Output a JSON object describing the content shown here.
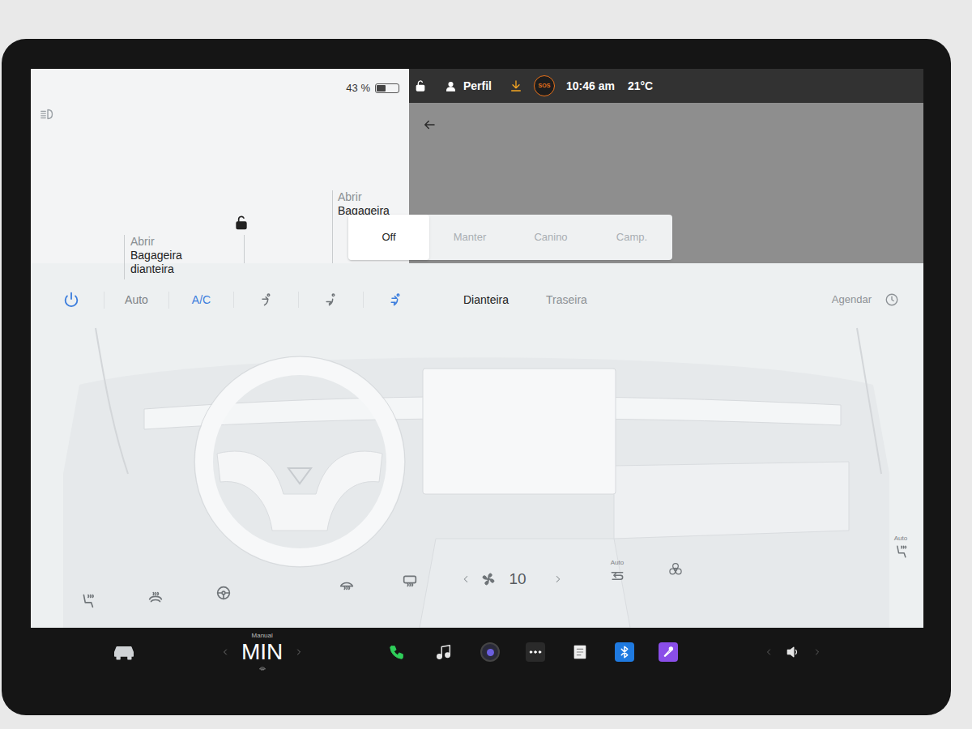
{
  "status_bar": {
    "battery": "43 %",
    "battery_level": 0.43,
    "locked": false,
    "profile": "Perfil",
    "sos": "SOS",
    "time": "10:46 am",
    "temperature": "21°C"
  },
  "car": {
    "locked": false,
    "frunk": {
      "action": "Abrir",
      "label": "Bagageira dianteira"
    },
    "trunk": {
      "action": "Abrir",
      "label": "Bagageira"
    }
  },
  "climate_keeper": [
    {
      "label": "Off",
      "selected": true,
      "disabled": false
    },
    {
      "label": "Manter",
      "selected": false,
      "disabled": true
    },
    {
      "label": "Canino",
      "selected": false,
      "disabled": true
    },
    {
      "label": "Camp.",
      "selected": false,
      "disabled": true
    }
  ],
  "climate": {
    "power": true,
    "modes": [
      {
        "label": "Auto",
        "selected": false
      },
      {
        "label": "A/C",
        "selected": true
      }
    ],
    "airflow": [
      {
        "selected": false
      },
      {
        "selected": false
      },
      {
        "selected": true
      }
    ],
    "zones": [
      {
        "label": "Dianteira",
        "selected": true
      },
      {
        "label": "Traseira",
        "selected": false
      }
    ],
    "schedule": "Agendar",
    "fan_speed": "10",
    "recirculation_label": "Auto",
    "passenger_seat_label": "Auto"
  },
  "dock": {
    "temp_mode": "Manual",
    "temp": "MIN"
  }
}
